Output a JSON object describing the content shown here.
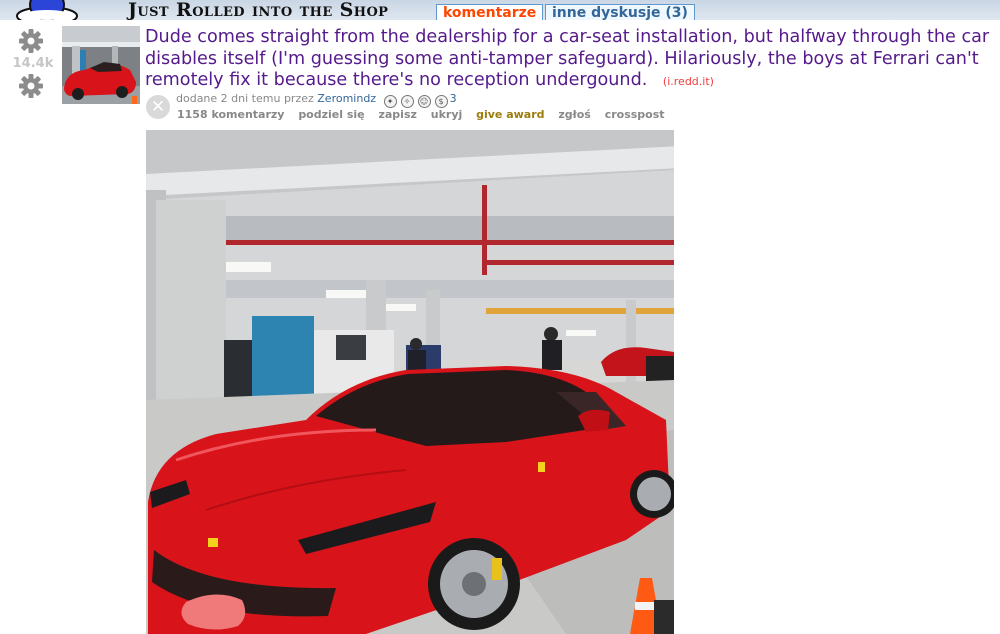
{
  "header": {
    "subreddit_title": "Just Rolled into the Shop",
    "tabs": [
      {
        "label": "komentarze",
        "selected": true
      },
      {
        "label": "inne dyskusje (3)",
        "selected": false
      }
    ]
  },
  "post": {
    "score": "14.4k",
    "title": "Dude comes straight from the dealership for a car-seat installation, but halfway through the car disables itself (I'm guessing some anti-tamper safeguard). Hilariously, the boys at Ferrari can't remotely fix it because there's no reception undergound.",
    "domain": "(i.redd.it)",
    "tagline_prefix": "dodane 2 dni temu przez",
    "author": "Zeromindz",
    "award_count": "3",
    "buttons": {
      "comments": "1158 komentarzy",
      "share": "podziel się",
      "save": "zapisz",
      "hide": "ukryj",
      "give_award": "give award",
      "report": "zgłoś",
      "crosspost": "crosspost"
    }
  },
  "colors": {
    "link_visited": "#551a8b",
    "domain": "#f23c3c",
    "selected_tab": "#ff4500",
    "tab_text": "#336699",
    "award_link": "#9a7d0a",
    "car_red": "#d8141a"
  },
  "icons": [
    "alien-logo-icon",
    "upvote-gear-icon",
    "downvote-gear-icon",
    "hide-x-icon",
    "award-icons"
  ]
}
